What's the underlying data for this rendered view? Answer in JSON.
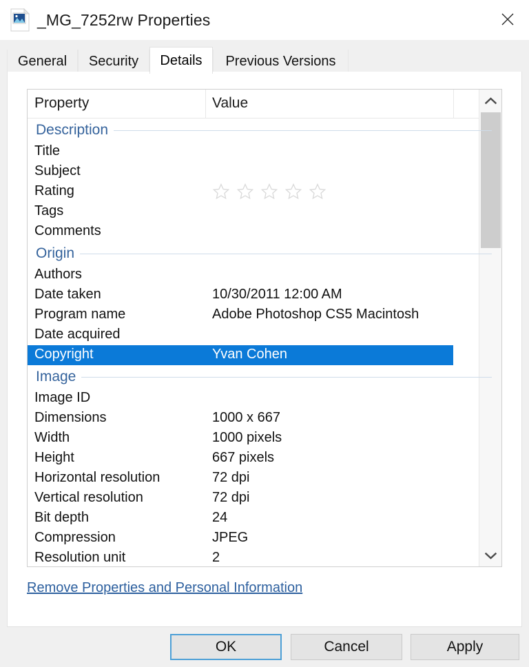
{
  "window": {
    "title": "_MG_7252rw Properties",
    "icon": "image-file-icon",
    "close_label": "✕"
  },
  "tabs": [
    {
      "label": "General",
      "selected": false
    },
    {
      "label": "Security",
      "selected": false
    },
    {
      "label": "Details",
      "selected": true
    },
    {
      "label": "Previous Versions",
      "selected": false
    }
  ],
  "columns": {
    "property": "Property",
    "value": "Value"
  },
  "groups": [
    {
      "title": "Description",
      "rows": [
        {
          "name": "Title",
          "value": ""
        },
        {
          "name": "Subject",
          "value": ""
        },
        {
          "name": "Rating",
          "value": "",
          "widget": "rating",
          "stars_total": 5,
          "stars_filled": 0
        },
        {
          "name": "Tags",
          "value": ""
        },
        {
          "name": "Comments",
          "value": ""
        }
      ]
    },
    {
      "title": "Origin",
      "rows": [
        {
          "name": "Authors",
          "value": ""
        },
        {
          "name": "Date taken",
          "value": "10/30/2011 12:00 AM"
        },
        {
          "name": "Program name",
          "value": "Adobe Photoshop CS5 Macintosh"
        },
        {
          "name": "Date acquired",
          "value": ""
        },
        {
          "name": "Copyright",
          "value": "Yvan Cohen",
          "selected": true
        }
      ]
    },
    {
      "title": "Image",
      "rows": [
        {
          "name": "Image ID",
          "value": ""
        },
        {
          "name": "Dimensions",
          "value": "1000 x 667"
        },
        {
          "name": "Width",
          "value": "1000 pixels"
        },
        {
          "name": "Height",
          "value": "667 pixels"
        },
        {
          "name": "Horizontal resolution",
          "value": "72 dpi"
        },
        {
          "name": "Vertical resolution",
          "value": "72 dpi"
        },
        {
          "name": "Bit depth",
          "value": "24"
        },
        {
          "name": "Compression",
          "value": "JPEG"
        },
        {
          "name": "Resolution unit",
          "value": "2",
          "clipped": true
        }
      ]
    }
  ],
  "scrollbar": {
    "up_arrow": "chevron-up-icon",
    "down_arrow": "chevron-down-icon"
  },
  "link": {
    "remove_properties": "Remove Properties and Personal Information"
  },
  "buttons": {
    "ok": "OK",
    "cancel": "Cancel",
    "apply": "Apply"
  },
  "colors": {
    "selection_blue": "#0b7ad8",
    "group_header_blue": "#35639c",
    "link_blue": "#2c5f9e",
    "focus_border": "#4c9fd6",
    "dialog_bg": "#f0f0f0"
  }
}
